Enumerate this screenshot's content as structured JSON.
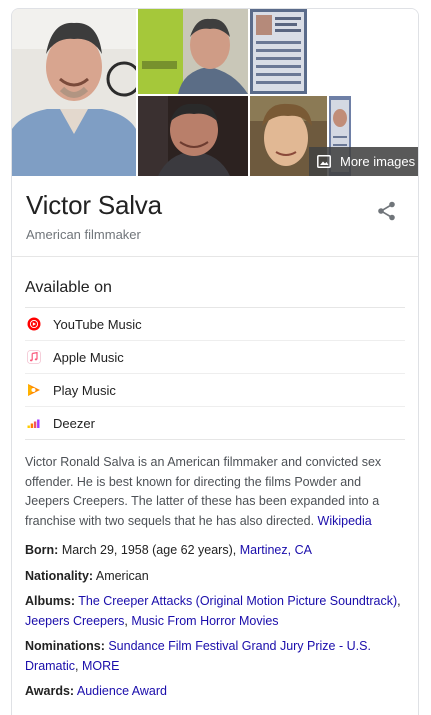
{
  "collage": {
    "more_images_label": "More images"
  },
  "entity": {
    "name": "Victor Salva",
    "description": "American filmmaker"
  },
  "available_on": {
    "heading": "Available on",
    "services": [
      {
        "label": "YouTube Music",
        "icon": "youtube-music-icon",
        "color": "#ff0000"
      },
      {
        "label": "Apple Music",
        "icon": "apple-music-icon",
        "color": "#fa5a7d"
      },
      {
        "label": "Play Music",
        "icon": "play-music-icon",
        "color": "#ff8a00"
      },
      {
        "label": "Deezer",
        "icon": "deezer-icon",
        "color": "#ef5466"
      }
    ]
  },
  "about": {
    "text": "Victor Ronald Salva is an American filmmaker and convicted sex offender. He is best known for directing the films Powder and Jeepers Creepers. The latter of these has been expanded into a franchise with two sequels that he has also directed.",
    "source_link": "Wikipedia"
  },
  "facts": {
    "born": {
      "label": "Born:",
      "value": "March 29, 1958 (age 62 years),",
      "place_link": "Martinez, CA"
    },
    "nationality": {
      "label": "Nationality:",
      "value": "American"
    },
    "albums": {
      "label": "Albums:",
      "items": [
        "The Creeper Attacks (Original Motion Picture Soundtrack)",
        "Jeepers Creepers",
        "Music From Horror Movies"
      ]
    },
    "nominations": {
      "label": "Nominations:",
      "item": "Sundance Film Festival Grand Jury Prize - U.S. Dramatic",
      "more_link": "MORE"
    },
    "awards": {
      "label": "Awards:",
      "item": "Audience Award"
    }
  },
  "colors": {
    "link": "#1a0dab",
    "text": "#222222",
    "secondary_text": "#70757a",
    "divider": "#e6e6e6",
    "overlay": "#424242"
  }
}
